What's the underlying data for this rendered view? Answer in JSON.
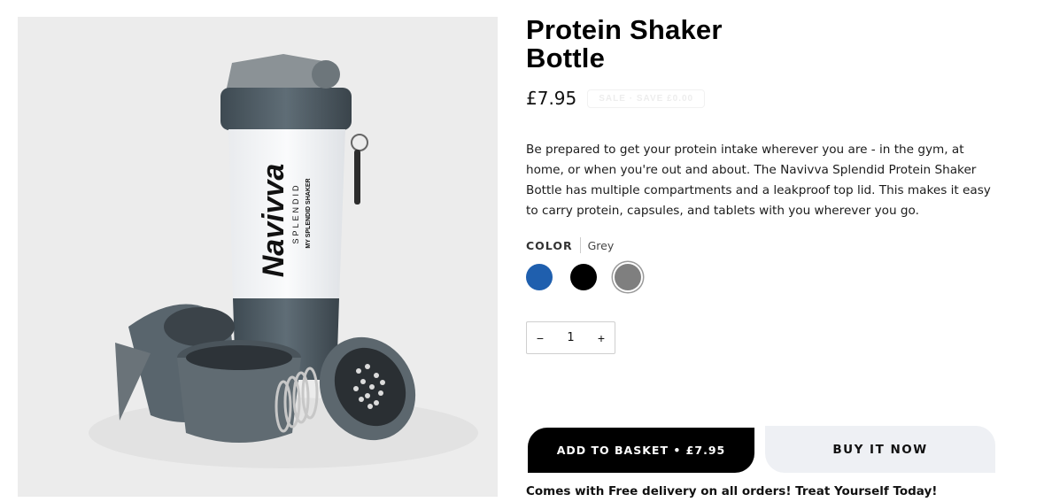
{
  "product": {
    "title_line1": "Protein Shaker",
    "title_line2": "Bottle",
    "price": "£7.95",
    "sale_badge": "SALE · SAVE £0.00",
    "description": "Be prepared to get your protein intake wherever you are - in the gym, at home, or when you're out and about. The Navivva Splendid Protein Shaker Bottle has multiple compartments and a leakproof top lid. This makes it easy to carry protein, capsules, and tablets with you wherever you go.",
    "image_brand": "Navivva",
    "image_sub": "SPLENDID",
    "image_tagline": "MY SPLENDID SHAKER"
  },
  "options": {
    "label": "COLOR",
    "selected": "Grey",
    "swatches": [
      {
        "name": "Blue",
        "color": "#1f5fae"
      },
      {
        "name": "Black",
        "color": "#000000"
      },
      {
        "name": "Grey",
        "color": "#7f7f7f"
      }
    ]
  },
  "quantity": {
    "minus": "−",
    "value": "1",
    "plus": "+"
  },
  "actions": {
    "add_to_basket": "ADD TO BASKET • £7.95",
    "buy_now": "BUY IT NOW"
  },
  "promo": "Comes with Free delivery on all orders! Treat Yourself Today!"
}
